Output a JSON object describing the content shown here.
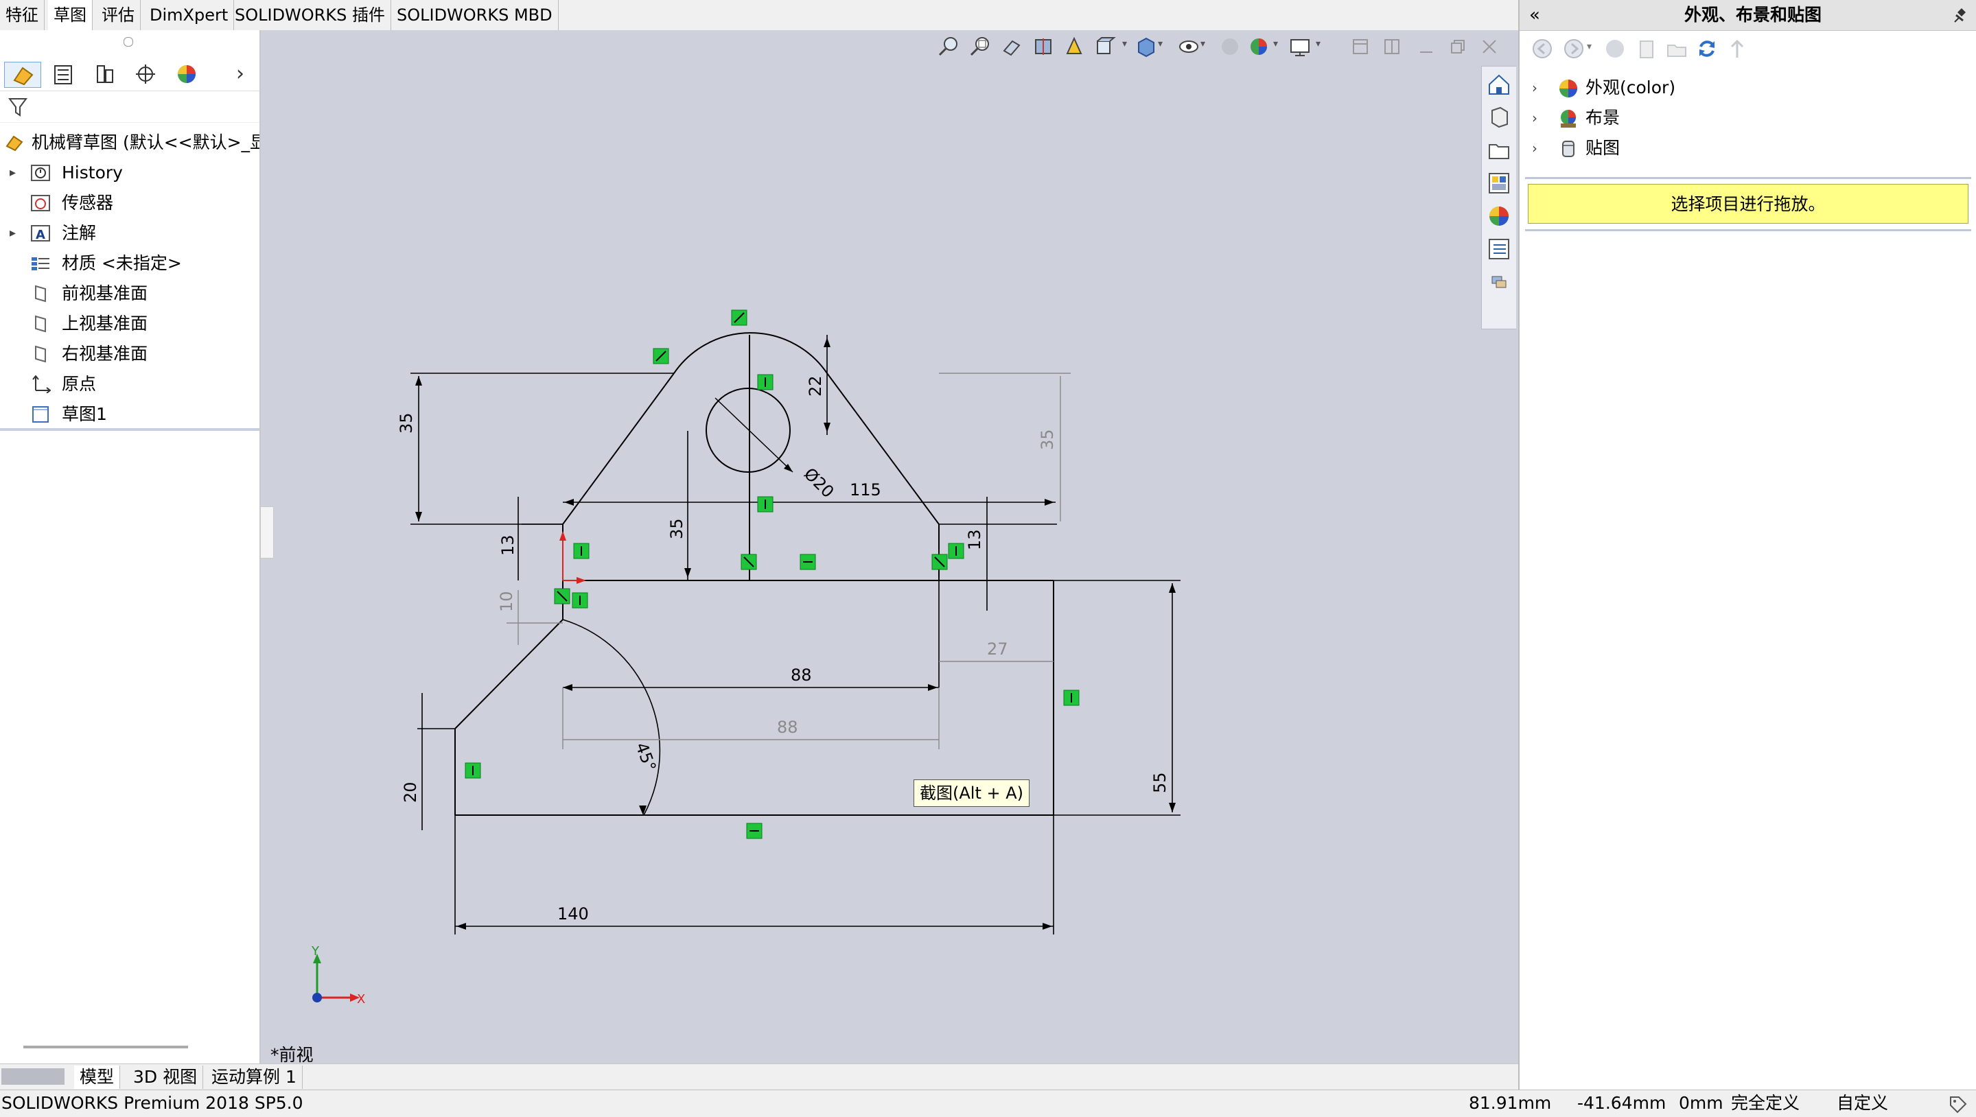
{
  "command_tabs": [
    "特征",
    "草图",
    "评估",
    "DimXpert",
    "SOLIDWORKS 插件",
    "SOLIDWORKS MBD"
  ],
  "active_command_tab": "草图",
  "feature_tree": {
    "part_name": "机械臂草图  (默认<<默认>_显示",
    "items": [
      {
        "label": "History",
        "icon": "history-icon",
        "expandable": true
      },
      {
        "label": "传感器",
        "icon": "sensor-icon",
        "expandable": false
      },
      {
        "label": "注解",
        "icon": "annotation-icon",
        "expandable": true
      },
      {
        "label": "材质 <未指定>",
        "icon": "material-icon",
        "expandable": false
      },
      {
        "label": "前视基准面",
        "icon": "plane-icon",
        "expandable": false
      },
      {
        "label": "上视基准面",
        "icon": "plane-icon",
        "expandable": false
      },
      {
        "label": "右视基准面",
        "icon": "plane-icon",
        "expandable": false
      },
      {
        "label": "原点",
        "icon": "origin-icon",
        "expandable": false
      },
      {
        "label": "草图1",
        "icon": "sketch-icon",
        "expandable": false
      }
    ]
  },
  "sketch": {
    "dimensions": {
      "left_height": "35",
      "top_arc_offset": "22",
      "right_height_ref": "35",
      "hole_diameter": "20",
      "top_width": "115",
      "center_height": "35",
      "left_step": "13",
      "right_step": "13",
      "small_offset_ref": "10",
      "right_offset_ref": "27",
      "inner_width": "88",
      "inner_width_ref": "88",
      "angle": "45°",
      "bottom_left_height": "20",
      "total_height": "55",
      "total_width": "140"
    },
    "axis_x_label": "X",
    "axis_y_label": "Y",
    "view_name": "*前视",
    "tooltip": "截图(Alt + A)"
  },
  "bottom_tabs": [
    "模型",
    "3D 视图",
    "运动算例 1"
  ],
  "active_bottom_tab": "模型",
  "status_bar": {
    "product": "SOLIDWORKS Premium 2018 SP5.0",
    "x_coord": "81.91mm",
    "y_coord": "-41.64mm",
    "z_coord": "0mm",
    "sketch_state": "完全定义",
    "units": "自定义"
  },
  "task_pane": {
    "title": "外观、布景和贴图",
    "items": [
      {
        "label": "外观(color)",
        "icon": "appearance-icon"
      },
      {
        "label": "布景",
        "icon": "scene-icon"
      },
      {
        "label": "贴图",
        "icon": "decal-icon"
      }
    ],
    "hint": "选择项目进行拖放。"
  },
  "colors": {
    "graphics_bg": "#ced1dc",
    "relation_green": "#1fc43a",
    "hint_yellow": "#ffff88"
  }
}
